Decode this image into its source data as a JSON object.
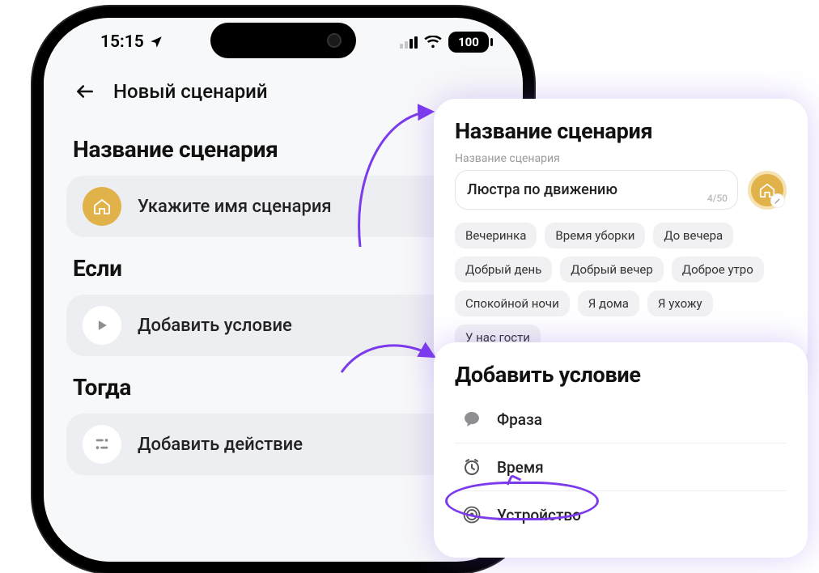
{
  "status": {
    "time": "15:15",
    "battery": "100"
  },
  "nav": {
    "title": "Новый сценарий"
  },
  "sections": {
    "name": {
      "title": "Название сценария",
      "row_label": "Укажите имя сценария"
    },
    "if": {
      "title": "Если",
      "row_label": "Добавить условие"
    },
    "then": {
      "title": "Тогда",
      "row_label": "Добавить действие"
    }
  },
  "popover_name": {
    "title": "Название сценария",
    "sub": "Название сценария",
    "value": "Люстра по движению",
    "counter": "4/50",
    "chips": [
      "Вечеринка",
      "Время уборки",
      "До вечера",
      "Добрый день",
      "Добрый вечер",
      "Доброе утро",
      "Спокойной ночи",
      "Я дома",
      "Я ухожу",
      "У нас гости"
    ]
  },
  "popover_condition": {
    "title": "Добавить условие",
    "items": [
      {
        "icon": "speech",
        "label": "Фраза"
      },
      {
        "icon": "clock",
        "label": "Время"
      },
      {
        "icon": "sensor",
        "label": "Устройство"
      }
    ]
  }
}
